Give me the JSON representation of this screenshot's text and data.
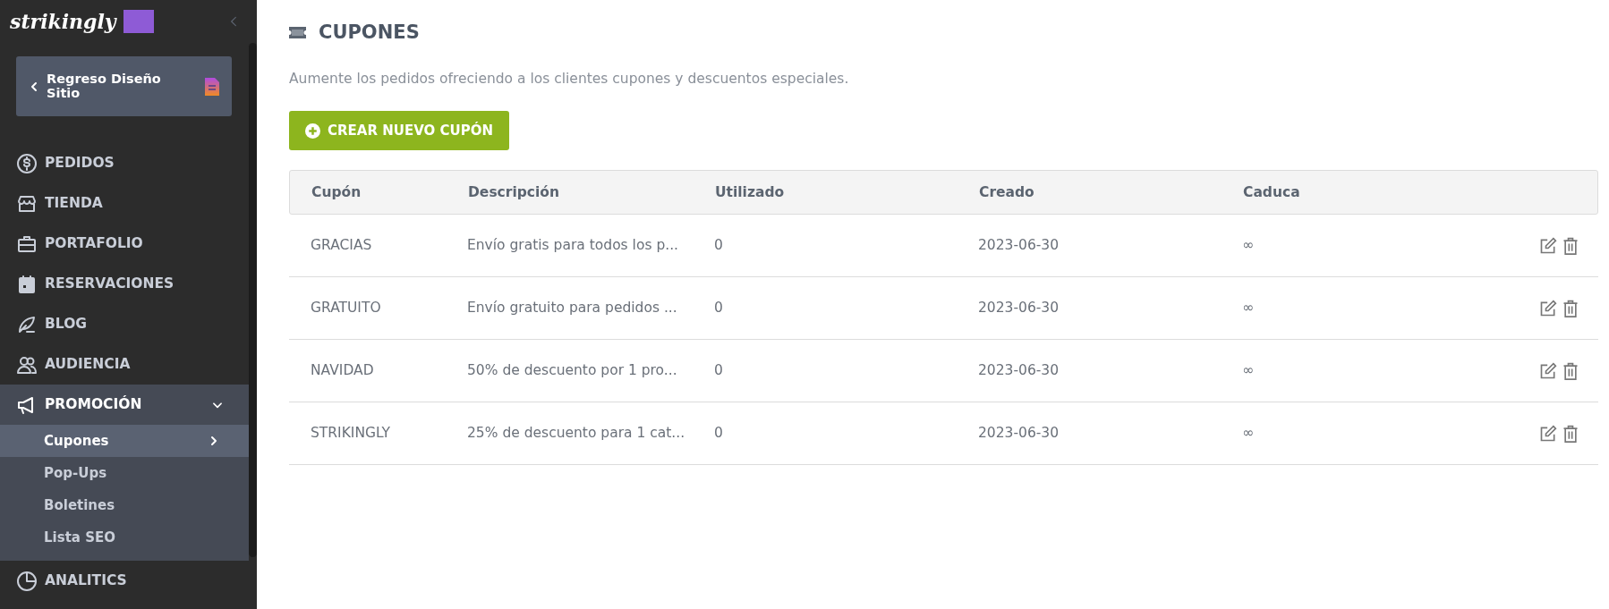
{
  "sidebar": {
    "logo": "strikingly",
    "back_button": "Regreso Diseño Sitio",
    "items": [
      {
        "label": "PEDIDOS",
        "expanded": false
      },
      {
        "label": "TIENDA",
        "expanded": false
      },
      {
        "label": "PORTAFOLIO",
        "expanded": false
      },
      {
        "label": "RESERVACIONES",
        "expanded": false
      },
      {
        "label": "BLOG",
        "expanded": false
      },
      {
        "label": "AUDIENCIA",
        "expanded": false
      },
      {
        "label": "PROMOCIÓN",
        "expanded": true,
        "children": [
          {
            "label": "Cupones",
            "selected": true
          },
          {
            "label": "Pop-Ups",
            "selected": false
          },
          {
            "label": "Boletines",
            "selected": false
          },
          {
            "label": "Lista SEO",
            "selected": false
          }
        ]
      },
      {
        "label": "ANALITICS",
        "expanded": false
      }
    ]
  },
  "page": {
    "title": "CUPONES",
    "description": "Aumente los pedidos ofreciendo a los clientes cupones y descuentos especiales.",
    "create_button": "CREAR NUEVO CUPÓN"
  },
  "table": {
    "columns": [
      "Cupón",
      "Descripción",
      "Utilizado",
      "Creado",
      "Caduca"
    ],
    "rows": [
      [
        "GRACIAS",
        "Envío gratis para todos los p...",
        "0",
        "2023-06-30",
        "∞"
      ],
      [
        "GRATUITO",
        "Envío gratuito para pedidos ...",
        "0",
        "2023-06-30",
        "∞"
      ],
      [
        "NAVIDAD",
        "50% de descuento por 1 pro...",
        "0",
        "2023-06-30",
        "∞"
      ],
      [
        "STRIKINGLY",
        "25% de descuento para 1 cat...",
        "0",
        "2023-06-30",
        "∞"
      ]
    ]
  }
}
